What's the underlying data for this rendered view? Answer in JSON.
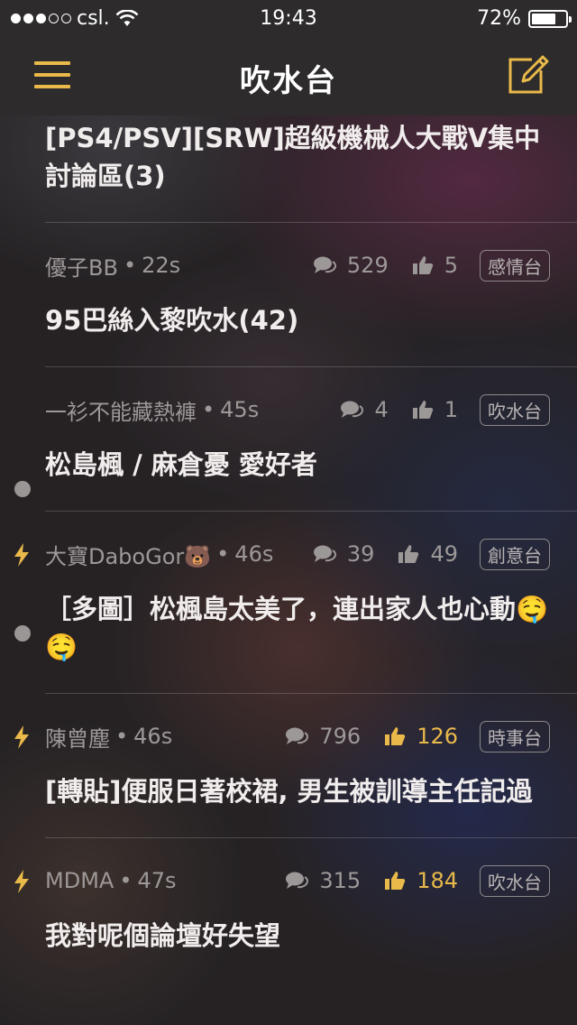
{
  "status_bar": {
    "carrier": "csl.",
    "time": "19:43",
    "battery": "72%",
    "battery_level": 0.72
  },
  "nav": {
    "title": "吹水台",
    "menu_icon": "hamburger-menu-icon",
    "compose_icon": "compose-icon"
  },
  "colors": {
    "accent": "#e9b94a",
    "meta_text": "#9d9898",
    "title_text": "#f1eded",
    "bar_bg": "#2d2b2b"
  },
  "posts": [
    {
      "title": "[PS4/PSV][SRW]超級機械人大戰V集中討論區(3)"
    },
    {
      "author": "優子BB",
      "time": "22s",
      "replies": "529",
      "likes": "5",
      "category": "感情台",
      "title": "95巴絲入黎吹水(42)"
    },
    {
      "author": "一衫不能藏熱褲",
      "time": "45s",
      "replies": "4",
      "likes": "1",
      "category": "吹水台",
      "title": "松島楓 / 麻倉憂 愛好者"
    },
    {
      "author": "大寶DaboGor🐻",
      "time": "46s",
      "replies": "39",
      "likes": "49",
      "category": "創意台",
      "title": "［多圖］松楓島太美了，連出家人也心動🤤 🤤"
    },
    {
      "author": "陳曾塵",
      "time": "46s",
      "replies": "796",
      "likes": "126",
      "category": "時事台",
      "title": "[轉貼]便服日著校裙, 男生被訓導主任記過"
    },
    {
      "author": "MDMA",
      "time": "47s",
      "replies": "315",
      "likes": "184",
      "category": "吹水台",
      "title": "我對呢個論壇好失望"
    }
  ]
}
